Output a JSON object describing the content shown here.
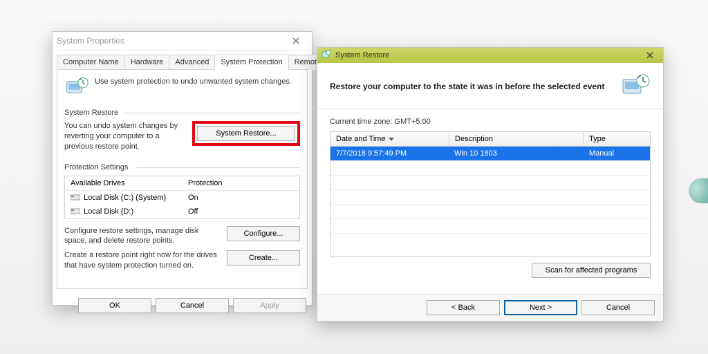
{
  "sp": {
    "title": "System Properties",
    "tabs": [
      "Computer Name",
      "Hardware",
      "Advanced",
      "System Protection",
      "Remote"
    ],
    "active_tab_index": 3,
    "intro": "Use system protection to undo unwanted system changes.",
    "group_sr": "System Restore",
    "sr_text": "You can undo system changes by reverting your computer to a previous restore point.",
    "sr_button": "System Restore...",
    "group_ps": "Protection Settings",
    "drives_headers": [
      "Available Drives",
      "Protection"
    ],
    "drives": [
      {
        "name": "Local Disk (C:) (System)",
        "protection": "On",
        "color": "#3aa1dd"
      },
      {
        "name": "Local Disk (D:)",
        "protection": "Off",
        "color": "#8a8a8a"
      }
    ],
    "configure_text": "Configure restore settings, manage disk space, and delete restore points.",
    "configure_button": "Configure...",
    "create_text": "Create a restore point right now for the drives that have system protection turned on.",
    "create_button": "Create...",
    "footer": {
      "ok": "OK",
      "cancel": "Cancel",
      "apply": "Apply"
    }
  },
  "sr": {
    "title": "System Restore",
    "heading": "Restore your computer to the state it was in before the selected event",
    "timezone": "Current time zone: GMT+5:00",
    "columns": [
      "Date and Time",
      "Description",
      "Type"
    ],
    "rows": [
      {
        "datetime": "7/7/2018 9:57:49 PM",
        "desc": "Win 10 1803",
        "type": "Manual"
      }
    ],
    "scan_button": "Scan for affected programs",
    "footer": {
      "back": "< Back",
      "next": "Next >",
      "cancel": "Cancel"
    }
  }
}
